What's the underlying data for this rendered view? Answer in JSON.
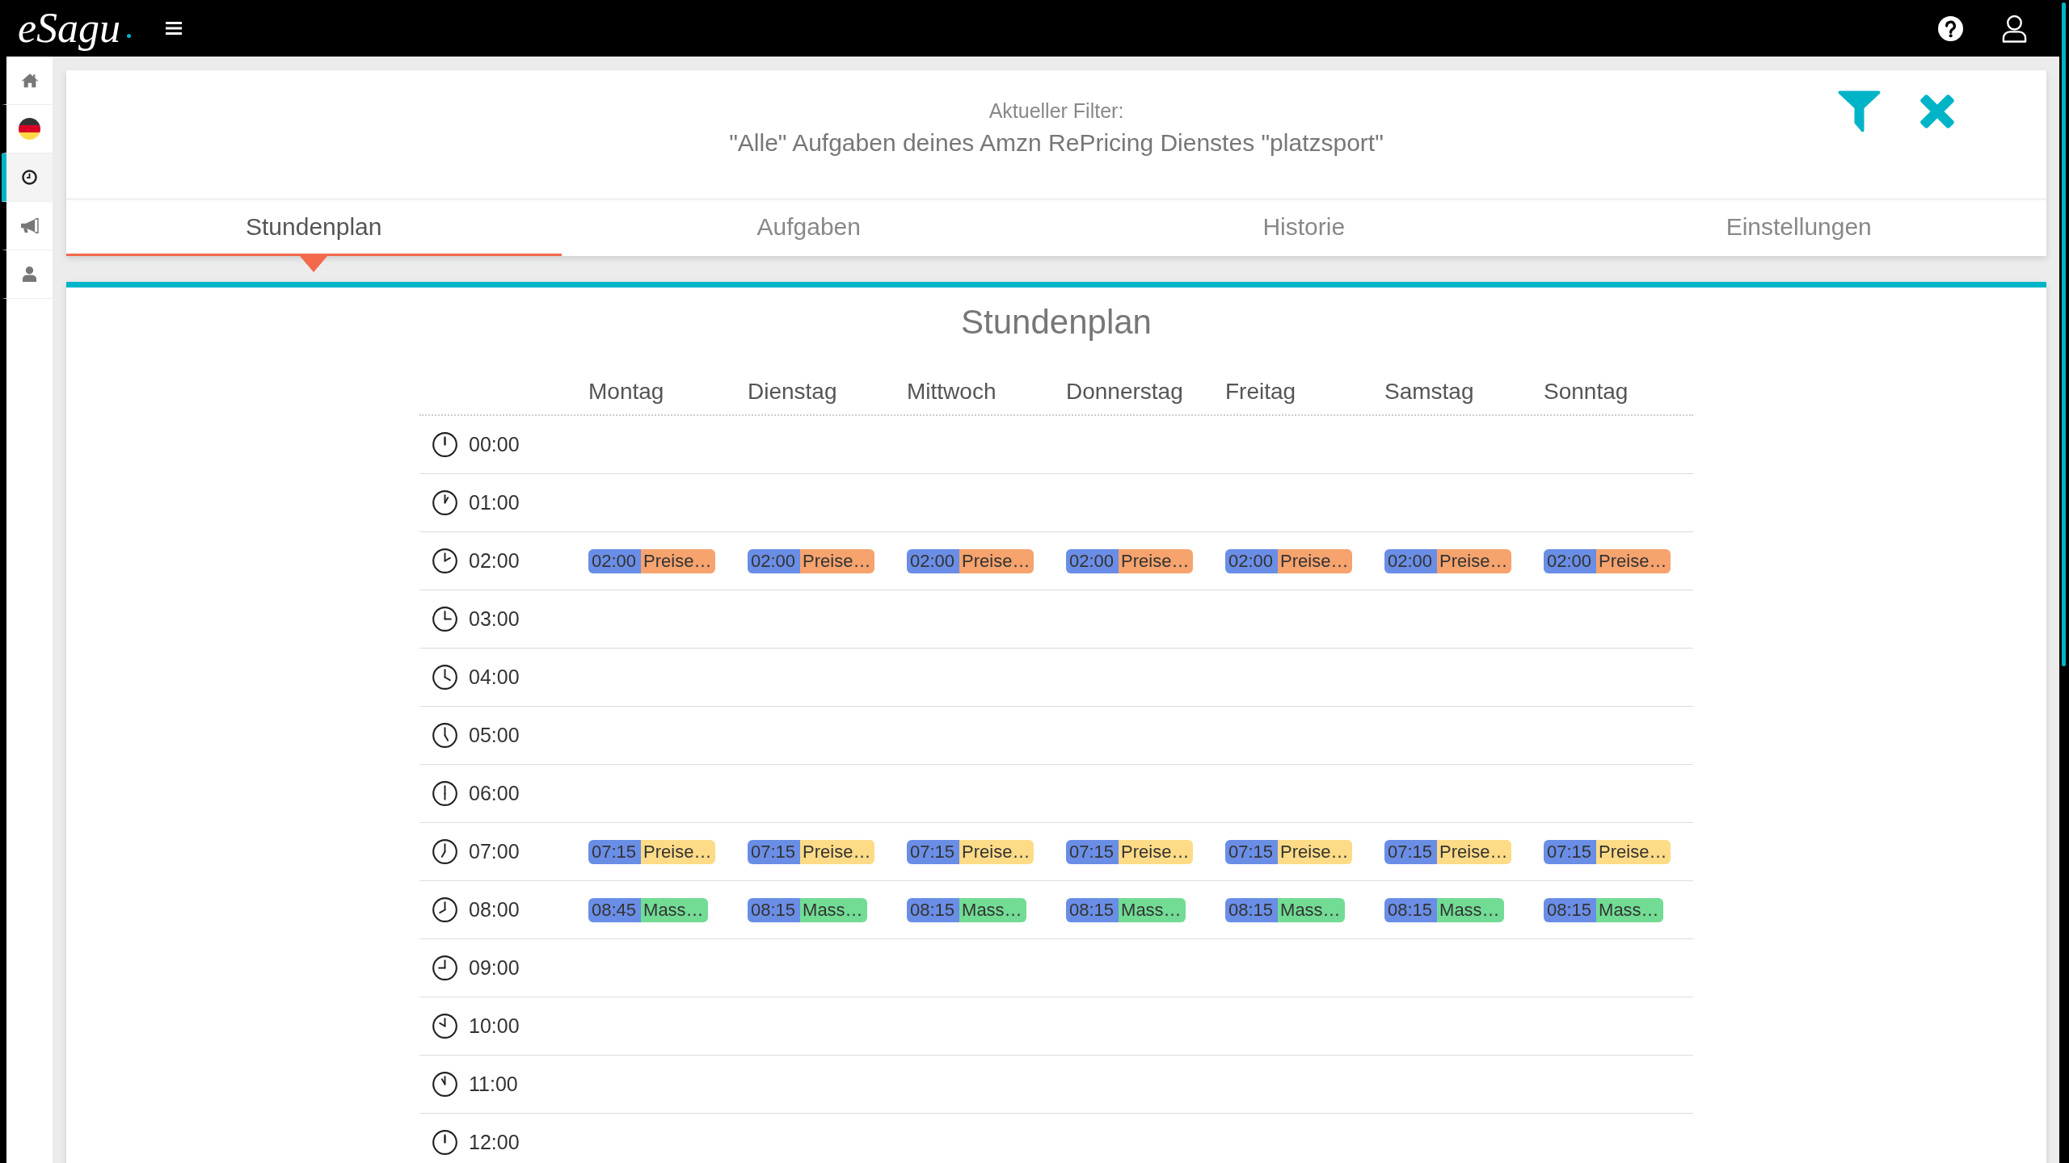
{
  "top_bar": {
    "logo": "eSagu"
  },
  "sidebar": {
    "items": [
      {
        "kind": "home",
        "selected": false
      },
      {
        "kind": "flag",
        "selected": false
      },
      {
        "kind": "clock",
        "selected": true
      },
      {
        "kind": "megaphone",
        "selected": false
      },
      {
        "kind": "user",
        "selected": false
      }
    ]
  },
  "filter": {
    "label": "Aktueller Filter:",
    "text": "\"Alle\" Aufgaben deines Amzn RePricing Dienstes \"platzsport\""
  },
  "tabs": [
    {
      "label": "Stundenplan",
      "selected": true
    },
    {
      "label": "Aufgaben",
      "selected": false
    },
    {
      "label": "Historie",
      "selected": false
    },
    {
      "label": "Einstellungen",
      "selected": false
    }
  ],
  "schedule": {
    "title": "Stundenplan",
    "days": [
      "Montag",
      "Dienstag",
      "Mittwoch",
      "Donnerstag",
      "Freitag",
      "Samstag",
      "Sonntag"
    ],
    "rows": [
      {
        "time": "00:00"
      },
      {
        "time": "01:00"
      },
      {
        "time": "02:00",
        "events": [
          {
            "time": "02:00",
            "label": "Preise…",
            "color": "#f6a36e"
          },
          {
            "time": "02:00",
            "label": "Preise…",
            "color": "#f6a36e"
          },
          {
            "time": "02:00",
            "label": "Preise…",
            "color": "#f6a36e"
          },
          {
            "time": "02:00",
            "label": "Preise…",
            "color": "#f6a36e"
          },
          {
            "time": "02:00",
            "label": "Preise…",
            "color": "#f6a36e"
          },
          {
            "time": "02:00",
            "label": "Preise…",
            "color": "#f6a36e"
          },
          {
            "time": "02:00",
            "label": "Preise…",
            "color": "#f6a36e"
          }
        ]
      },
      {
        "time": "03:00"
      },
      {
        "time": "04:00"
      },
      {
        "time": "05:00"
      },
      {
        "time": "06:00"
      },
      {
        "time": "07:00",
        "events": [
          {
            "time": "07:15",
            "label": "Preise…",
            "color": "#fedb86"
          },
          {
            "time": "07:15",
            "label": "Preise…",
            "color": "#fedb86"
          },
          {
            "time": "07:15",
            "label": "Preise…",
            "color": "#fedb86"
          },
          {
            "time": "07:15",
            "label": "Preise…",
            "color": "#fedb86"
          },
          {
            "time": "07:15",
            "label": "Preise…",
            "color": "#fedb86"
          },
          {
            "time": "07:15",
            "label": "Preise…",
            "color": "#fedb86"
          },
          {
            "time": "07:15",
            "label": "Preise…",
            "color": "#fedb86"
          }
        ]
      },
      {
        "time": "08:00",
        "events": [
          {
            "time": "08:45",
            "label": "Mass…",
            "color": "#72dc94"
          },
          {
            "time": "08:15",
            "label": "Mass…",
            "color": "#72dc94"
          },
          {
            "time": "08:15",
            "label": "Mass…",
            "color": "#72dc94"
          },
          {
            "time": "08:15",
            "label": "Mass…",
            "color": "#72dc94"
          },
          {
            "time": "08:15",
            "label": "Mass…",
            "color": "#72dc94"
          },
          {
            "time": "08:15",
            "label": "Mass…",
            "color": "#72dc94"
          },
          {
            "time": "08:15",
            "label": "Mass…",
            "color": "#72dc94"
          }
        ]
      },
      {
        "time": "09:00"
      },
      {
        "time": "10:00"
      },
      {
        "time": "11:00"
      },
      {
        "time": "12:00"
      }
    ]
  }
}
